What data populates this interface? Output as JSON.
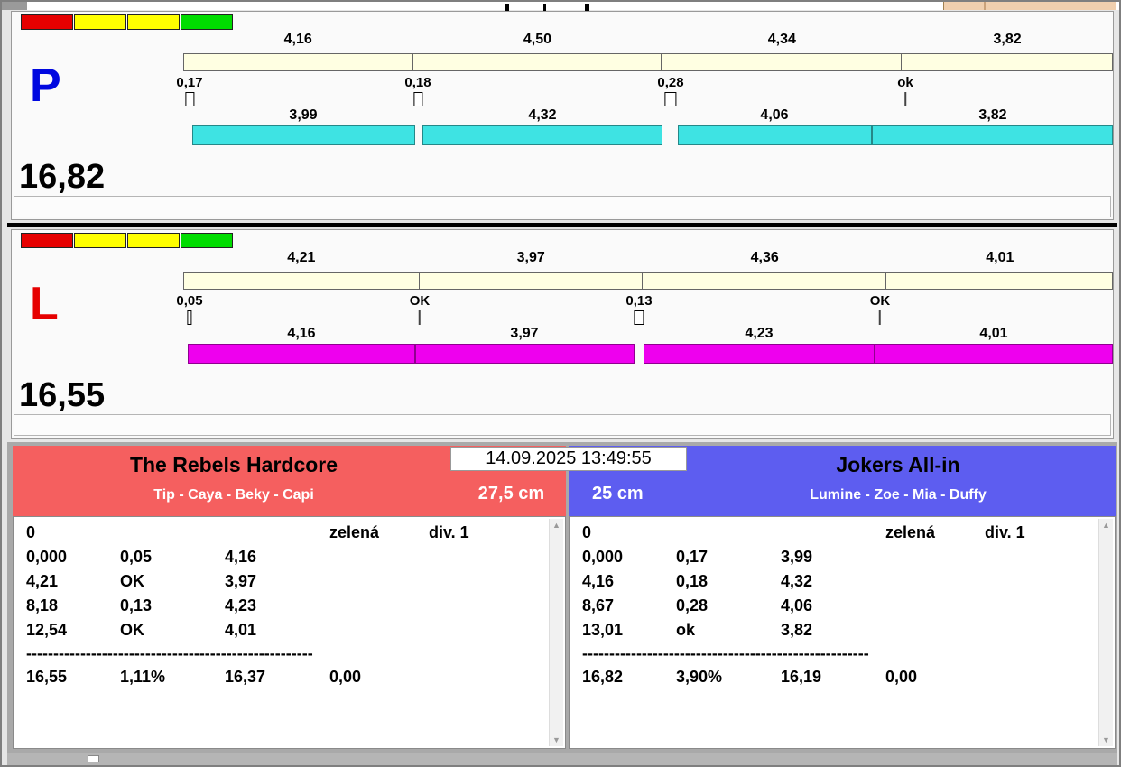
{
  "window": {
    "top_right_strip_color": "#f0cfae"
  },
  "traffic_light_colors": [
    "#e60000",
    "#ffff00",
    "#ffff00",
    "#00dc00"
  ],
  "panels": [
    {
      "letter": "P",
      "letter_color": "#0008e0",
      "total": "16,82",
      "run_bar_color": "#3ee3e3",
      "splits_top": [
        "4,16",
        "4,50",
        "4,34",
        "3,82"
      ],
      "changes": [
        "0,17",
        "0,18",
        "0,28",
        "ok"
      ],
      "splits_bottom": [
        "3,99",
        "4,32",
        "4,06",
        "3,82"
      ]
    },
    {
      "letter": "L",
      "letter_color": "#e60000",
      "total": "16,55",
      "run_bar_color": "#ee00ee",
      "splits_top": [
        "4,21",
        "3,97",
        "4,36",
        "4,01"
      ],
      "changes": [
        "0,05",
        "OK",
        "0,13",
        "OK"
      ],
      "splits_bottom": [
        "4,16",
        "3,97",
        "4,23",
        "4,01"
      ]
    }
  ],
  "results": {
    "timestamp": "14.09.2025 13:49:55",
    "left": {
      "team": "The Rebels Hardcore",
      "dogs": "Tip - Caya - Beky - Capi",
      "height": "27,5 cm",
      "header_color": "#f55f5f",
      "rows": [
        [
          "0",
          "",
          "",
          "zelená",
          "div. 1"
        ],
        [
          "0,000",
          "0,05",
          "4,16",
          "",
          ""
        ],
        [
          "4,21",
          "OK",
          "3,97",
          "",
          ""
        ],
        [
          "8,18",
          "0,13",
          "4,23",
          "",
          ""
        ],
        [
          "12,54",
          "OK",
          "4,01",
          "",
          ""
        ]
      ],
      "dashes": "-----------------------------------------------------",
      "total_row": [
        "16,55",
        "1,11%",
        "16,37",
        "0,00"
      ]
    },
    "right": {
      "team": "Jokers All-in",
      "dogs": "Lumine - Zoe - Mia - Duffy",
      "height": "25 cm",
      "header_color": "#5d5df0",
      "rows": [
        [
          "0",
          "",
          "",
          "zelená",
          "div. 1"
        ],
        [
          "0,000",
          "0,17",
          "3,99",
          "",
          ""
        ],
        [
          "4,16",
          "0,18",
          "4,32",
          "",
          ""
        ],
        [
          "8,67",
          "0,28",
          "4,06",
          "",
          ""
        ],
        [
          "13,01",
          "ok",
          "3,82",
          "",
          ""
        ]
      ],
      "dashes": "-----------------------------------------------------",
      "total_row": [
        "16,82",
        "3,90%",
        "16,19",
        "0,00"
      ]
    }
  }
}
